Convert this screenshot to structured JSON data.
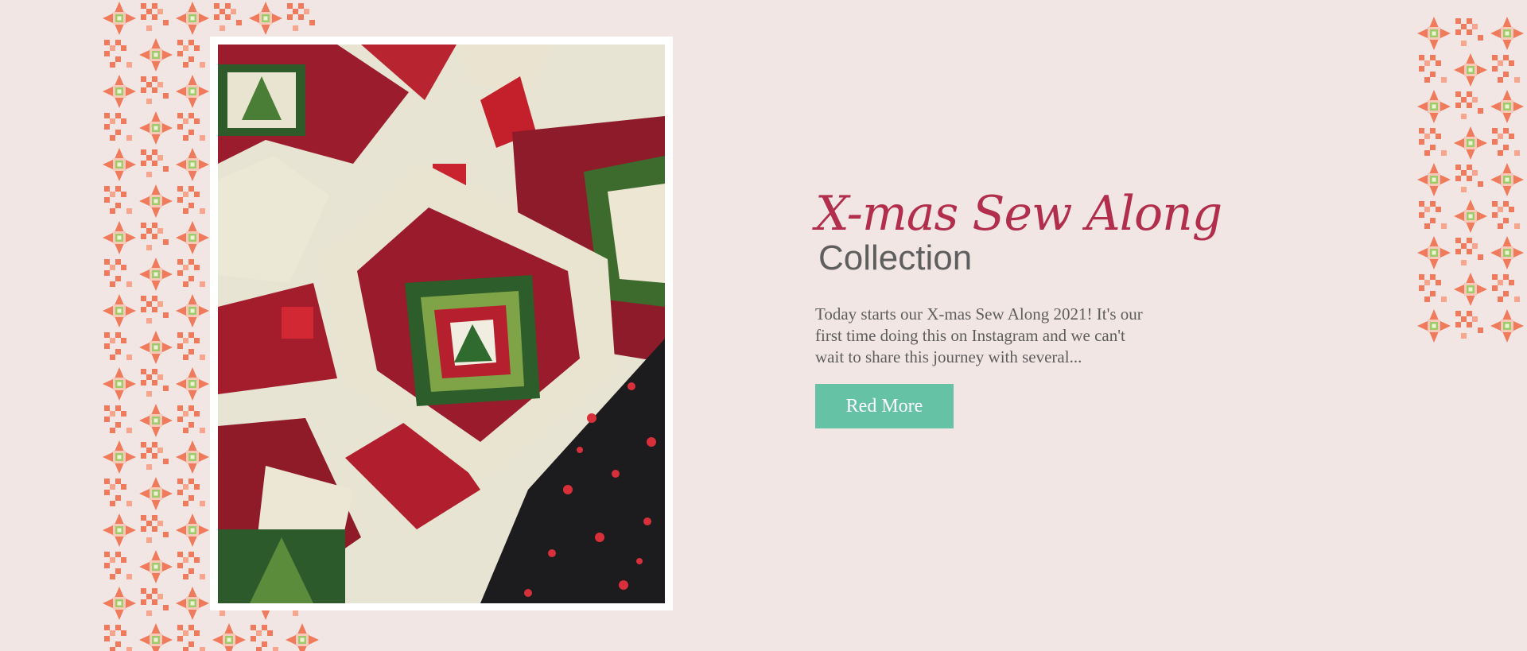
{
  "post": {
    "title_script": "X-mas Sew Along",
    "title_sub": "Collection",
    "excerpt": "Today starts our X-mas Sew Along 2021! It's our first time doing this on Instagram and we can't wait to share this journey with several...",
    "read_more_label": "Red More"
  },
  "images": {
    "photo": "christmas-quilt-and-pillow-photo",
    "pattern_left": "quilt-star-pattern-decoration",
    "pattern_right": "quilt-star-pattern-decoration"
  },
  "colors": {
    "background": "#f2e6e4",
    "accent_title": "#b12e4c",
    "button": "#66c2a5",
    "pattern_coral": "#f07a5c",
    "pattern_green": "#9fcb6a"
  }
}
